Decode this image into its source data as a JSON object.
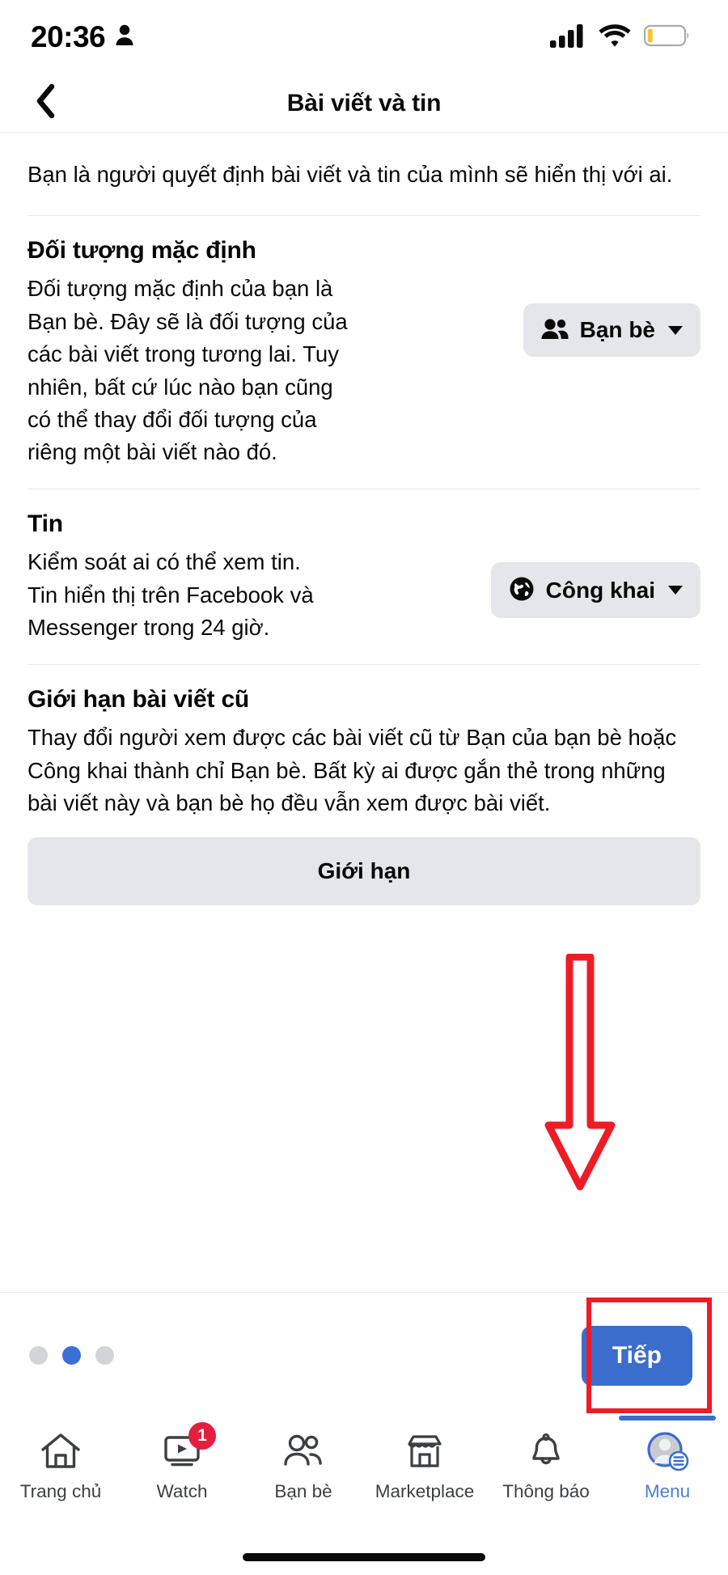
{
  "status_bar": {
    "time": "20:36",
    "person_icon": "person-icon",
    "signal_icon": "cellular-signal-icon",
    "wifi_icon": "wifi-icon",
    "battery_icon": "battery-low-icon",
    "battery_color": "#f5c431"
  },
  "header": {
    "back_icon": "back-chevron-icon",
    "title": "Bài viết và tin"
  },
  "intro": "Bạn là người quyết định bài viết và tin của mình sẽ hiển thị với ai.",
  "sections": [
    {
      "id": "default-audience",
      "title": "Đối tượng mặc định",
      "description": "Đối tượng mặc định của bạn là Bạn bè. Đây sẽ là đối tượng của các bài viết trong tương lai. Tuy nhiên, bất cứ lúc nào bạn cũng có thể thay đổi đối tượng của riêng một bài viết nào đó.",
      "control": {
        "type": "dropdown",
        "icon": "friends-icon",
        "label": "Bạn bè",
        "caret": "chevron-down-icon"
      }
    },
    {
      "id": "stories",
      "title": "Tin",
      "description": "Kiểm soát ai có thể xem tin. Tin hiển thị trên Facebook và Messenger trong 24 giờ.",
      "control": {
        "type": "dropdown",
        "icon": "globe-icon",
        "label": "Công khai",
        "caret": "chevron-down-icon"
      }
    },
    {
      "id": "limit-past-posts",
      "title": "Giới hạn bài viết cũ",
      "description": "Thay đổi người xem được các bài viết cũ từ Bạn của bạn bè hoặc Công khai thành chỉ Bạn bè. Bất kỳ ai được gắn thẻ trong những bài viết này và bạn bè họ đều vẫn xem được bài viết.",
      "control": {
        "type": "button",
        "label": "Giới hạn"
      }
    }
  ],
  "annotations": {
    "arrow": {
      "name": "red-down-arrow",
      "color": "#ee1c25"
    },
    "highlight_box": {
      "name": "red-highlight-box",
      "color": "#ee1c25",
      "target": "next-button"
    }
  },
  "footer": {
    "pagination": {
      "total": 3,
      "active_index": 1,
      "active_color": "#3b6fd4",
      "inactive_color": "#d2d4d8"
    },
    "next_label": "Tiếp",
    "next_color": "#3a6dcd"
  },
  "tabbar": {
    "items": [
      {
        "id": "home",
        "icon": "home-icon",
        "label": "Trang chủ",
        "active": false,
        "badge": null
      },
      {
        "id": "watch",
        "icon": "watch-icon",
        "label": "Watch",
        "active": false,
        "badge": "1"
      },
      {
        "id": "friends",
        "icon": "friends-icon",
        "label": "Bạn bè",
        "active": false,
        "badge": null
      },
      {
        "id": "marketplace",
        "icon": "marketplace-icon",
        "label": "Marketplace",
        "active": false,
        "badge": null
      },
      {
        "id": "notifications",
        "icon": "bell-icon",
        "label": "Thông báo",
        "active": false,
        "badge": null
      },
      {
        "id": "menu",
        "icon": "menu-avatar-icon",
        "label": "Menu",
        "active": true,
        "badge": null
      }
    ]
  }
}
